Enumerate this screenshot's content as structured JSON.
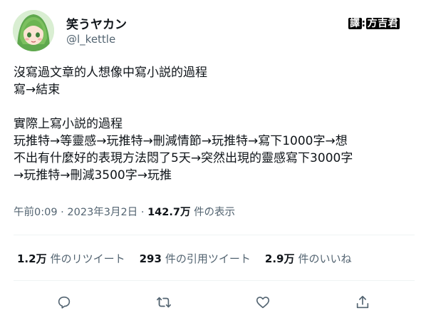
{
  "author": {
    "display_name": "笑うヤカン",
    "handle": "@l_kettle"
  },
  "watermark": {
    "prefix": "譯",
    "separator": ":",
    "name": "方吉君"
  },
  "tweet": {
    "lines": [
      "沒寫過文章的人想像中寫小説的過程",
      "寫→結束",
      "",
      "實際上寫小説的過程",
      "玩推特→等靈感→玩推特→刪減情節→玩推特→寫下1000字→想",
      "不出有什麼好的表現方法悶了5天→突然出現的靈感寫下3000字",
      "→玩推特→刪減3500字→玩推"
    ]
  },
  "meta": {
    "time": "午前0:09",
    "separator": " · ",
    "date": "2023年3月2日",
    "views_count": "142.7万",
    "views_label": "件の表示"
  },
  "stats": {
    "retweets_count": "1.2万",
    "retweets_label": "件のリツイート",
    "quotes_count": "293",
    "quotes_label": "件の引用ツイート",
    "likes_count": "2.9万",
    "likes_label": "件のいいね"
  },
  "colors": {
    "text": "#0f1419",
    "secondary": "#536471",
    "divider": "#eff3f4"
  },
  "icons": [
    "reply-icon",
    "retweet-icon",
    "like-icon",
    "share-icon"
  ]
}
